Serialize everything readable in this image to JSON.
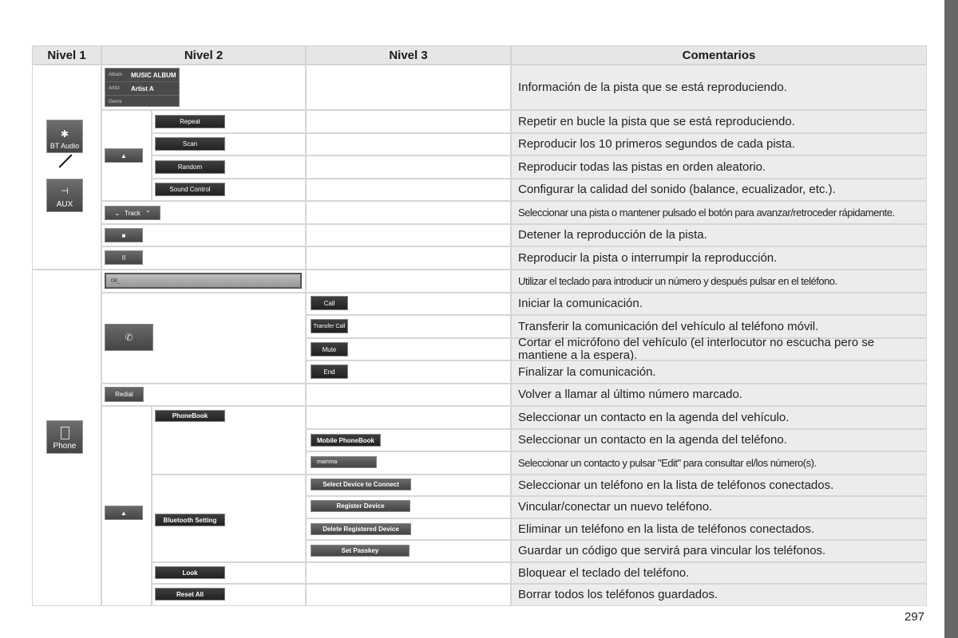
{
  "headers": {
    "nivel1": "Nivel 1",
    "nivel2": "Nivel 2",
    "nivel3": "Nivel 3",
    "comentarios": "Comentarios"
  },
  "audio": {
    "source_bt": {
      "label": "BT Audio",
      "icon": "bluetooth-icon"
    },
    "source_aux": {
      "label": "AUX",
      "icon": "aux-cable-icon"
    },
    "info_box": {
      "album_label": "Album",
      "album_value": "MUSIC ALBUM",
      "artist_label": "Artist",
      "artist_value": "Artist A",
      "genre_label": "Genre"
    },
    "menu_button": {
      "icon": "triangle-up-icon",
      "glyph": "▲"
    },
    "menu_items": [
      "Repeat",
      "Scan",
      "Random",
      "Sound Control"
    ],
    "track_button": {
      "label": "Track",
      "left_glyph": "⌄",
      "right_glyph": "⌃"
    },
    "stop_glyph": "■",
    "pause_glyph": "II"
  },
  "phone": {
    "source": {
      "label": "Phone",
      "icon": "phone-device-icon"
    },
    "input_value": "08_",
    "handset_icon": "handset-icon",
    "call_options": [
      "Call",
      "Transfer Call",
      "Mute",
      "End"
    ],
    "redial": "Redial",
    "menu_button": {
      "glyph": "▲"
    },
    "phonebook": "PhoneBook",
    "phonebook_items": [
      "Mobile PhoneBook",
      "mamma"
    ],
    "bluetooth_setting": "Bluetooth Setting",
    "bluetooth_items": [
      "Select Device to  Connect",
      "Register Device",
      "Delete Registered Device",
      "Set Passkey"
    ],
    "lock": "Look",
    "reset_all": "Reset All"
  },
  "comments": [
    "Información de la pista que se está reproduciendo.",
    "Repetir en bucle la pista que se está reproduciendo.",
    "Reproducir los 10 primeros segundos de cada pista.",
    "Reproducir todas las pistas en orden aleatorio.",
    "Configurar la calidad del sonido (balance, ecualizador, etc.).",
    "Seleccionar una pista o mantener pulsado el botón para avanzar/retroceder rápidamente.",
    "Detener la reproducción de la pista.",
    "Reproducir la pista o interrumpir la reproducción.",
    "Utilizar el teclado para introducir un número y después pulsar en el teléfono.",
    "Iniciar la comunicación.",
    "Transferir la comunicación del vehículo al teléfono móvil.",
    "Cortar el micrófono del vehículo (el interlocutor no escucha pero se mantiene a la espera).",
    "Finalizar la comunicación.",
    "Volver a llamar al último número marcado.",
    "Seleccionar un contacto en la agenda del vehículo.",
    "Seleccionar un contacto en la agenda del teléfono.",
    "Seleccionar un contacto y pulsar \"Edit\" para consultar el/los número(s).",
    "Seleccionar un teléfono en la lista de teléfonos conectados.",
    "Vincular/conectar un nuevo teléfono.",
    "Eliminar un teléfono en la lista de teléfonos conectados.",
    "Guardar un código que servirá para vincular los teléfonos.",
    "Bloquear el teclado del teléfono.",
    "Borrar todos los teléfonos guardados."
  ],
  "page_number": "297"
}
